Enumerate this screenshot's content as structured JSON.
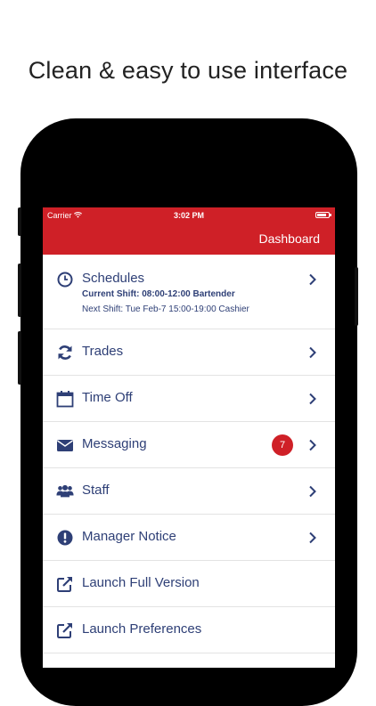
{
  "headline": "Clean & easy to use interface",
  "status_bar": {
    "carrier": "Carrier",
    "time": "3:02 PM"
  },
  "header": {
    "title": "Dashboard"
  },
  "colors": {
    "brand_red": "#cf2027",
    "text_navy": "#2e3f76"
  },
  "menu": {
    "schedules": {
      "label": "Schedules",
      "current_shift": "Current Shift: 08:00-12:00 Bartender",
      "next_shift": "Next Shift: Tue Feb-7 15:00-19:00 Cashier",
      "icon": "clock-icon"
    },
    "trades": {
      "label": "Trades",
      "icon": "refresh-icon"
    },
    "time_off": {
      "label": "Time Off",
      "icon": "calendar-icon"
    },
    "messaging": {
      "label": "Messaging",
      "badge": "7",
      "icon": "envelope-icon"
    },
    "staff": {
      "label": "Staff",
      "icon": "users-icon"
    },
    "manager_notice": {
      "label": "Manager Notice",
      "icon": "exclamation-circle-icon"
    },
    "launch_full": {
      "label": "Launch Full Version",
      "icon": "external-link-icon"
    },
    "launch_prefs": {
      "label": "Launch Preferences",
      "icon": "external-link-icon"
    }
  }
}
